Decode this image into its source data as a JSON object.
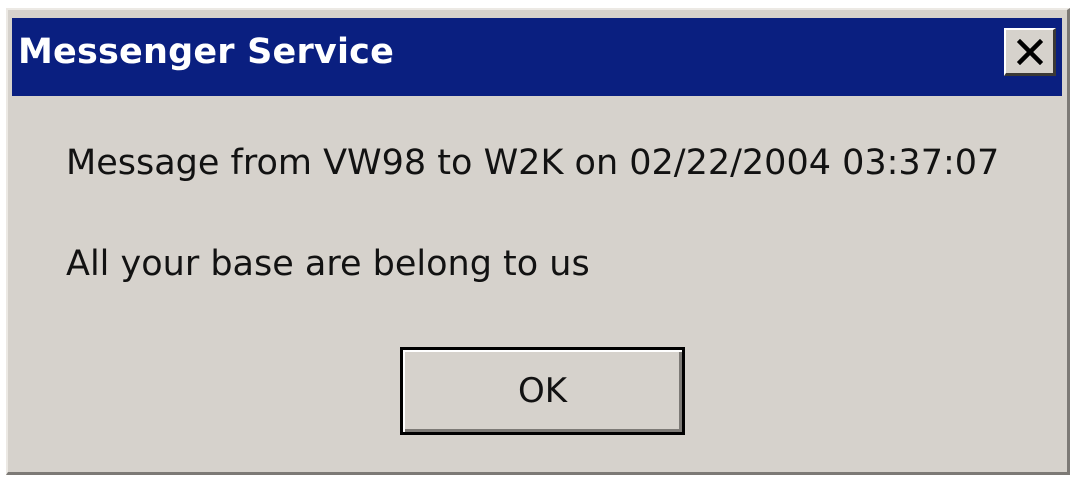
{
  "window": {
    "title": "Messenger Service",
    "close_icon": "close-icon"
  },
  "message": {
    "header": "Message from VW98 to W2K on 02/22/2004 03:37:07",
    "body": "All your base are belong to us"
  },
  "buttons": {
    "ok_label": "OK"
  },
  "colors": {
    "titlebar": "#0a1f80",
    "dialog_face": "#d6d2cc"
  }
}
